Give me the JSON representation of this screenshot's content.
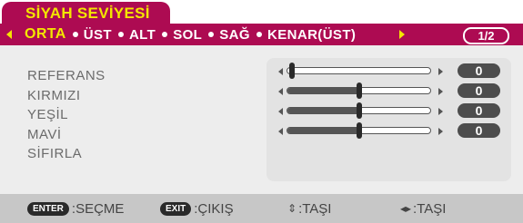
{
  "title": "SİYAH SEVİYESİ",
  "subtabs": {
    "items": [
      "ORTA",
      "ÜST",
      "ALT",
      "SOL",
      "SAĞ",
      "KENAR(ÜST)"
    ],
    "active_index": 0,
    "page": "1/2"
  },
  "settings": [
    {
      "label": "REFERANS",
      "value": "0",
      "level": 0.0
    },
    {
      "label": "KIRMIZI",
      "value": "0",
      "level": 0.5
    },
    {
      "label": "YEŞİL",
      "value": "0",
      "level": 0.5
    },
    {
      "label": "MAVİ",
      "value": "0",
      "level": 0.5
    }
  ],
  "reset_label": "SİFIRLA",
  "footer": {
    "enter_key": "ENTER",
    "enter_label": ":SEÇME",
    "exit_key": "EXIT",
    "exit_label": ":ÇIKIŞ",
    "updown_icon": "updown-arrows-icon",
    "updown_label": ":TAŞI",
    "leftright_icon": "leftright-arrows-icon",
    "leftright_label": ":TAŞI"
  },
  "colors": {
    "accent": "#ad0b52",
    "title_text": "#f3e600",
    "panel_bg": "#ededed",
    "footer_bg": "#c7c7c7"
  }
}
